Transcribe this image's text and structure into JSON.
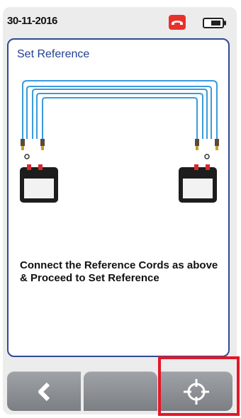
{
  "status": {
    "date": "30-11-2016",
    "phone_icon": "phone-hangup-icon",
    "battery_icon": "battery-icon"
  },
  "panel": {
    "title": "Set Reference",
    "message": "Connect the Reference Cords as above & Proceed to Set Reference"
  },
  "diagram": {
    "icons": [
      "reference-cord-icon",
      "tester-device-icon"
    ]
  },
  "toolbar": {
    "buttons": [
      {
        "name": "back",
        "icon": "chevron-left-icon"
      },
      {
        "name": "blank",
        "icon": ""
      },
      {
        "name": "set-reference",
        "icon": "crosshair-icon"
      }
    ]
  },
  "colors": {
    "accent": "#1f3f93",
    "panel_border": "#2f4a92",
    "cord": "#3a9bdc",
    "alert_red": "#e3172a",
    "button_gray": "#8c9094"
  }
}
